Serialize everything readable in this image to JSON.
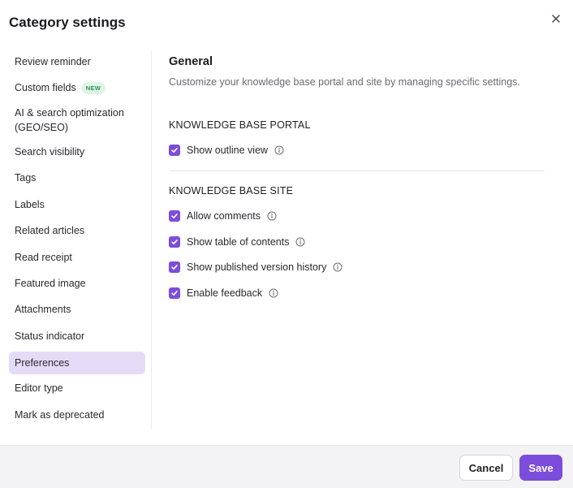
{
  "modal": {
    "title": "Category settings",
    "close_icon": "close-icon"
  },
  "sidebar": {
    "items": [
      {
        "label": "Review reminder"
      },
      {
        "label": "Custom fields",
        "badge": "NEW"
      },
      {
        "label": "AI & search optimization (GEO/SEO)"
      },
      {
        "label": "Search visibility"
      },
      {
        "label": "Tags"
      },
      {
        "label": "Labels"
      },
      {
        "label": "Related articles"
      },
      {
        "label": "Read receipt"
      },
      {
        "label": "Featured image"
      },
      {
        "label": "Attachments"
      },
      {
        "label": "Status indicator"
      },
      {
        "label": "Preferences",
        "active": true
      },
      {
        "label": "Editor type"
      },
      {
        "label": "Mark as deprecated"
      }
    ]
  },
  "main": {
    "title": "General",
    "description": "Customize your knowledge base portal and site by managing specific settings.",
    "groups": [
      {
        "heading": "KNOWLEDGE BASE PORTAL",
        "options": [
          {
            "label": "Show outline view",
            "checked": true
          }
        ]
      },
      {
        "heading": "KNOWLEDGE BASE SITE",
        "options": [
          {
            "label": "Allow comments",
            "checked": true
          },
          {
            "label": "Show table of contents",
            "checked": true
          },
          {
            "label": "Show published version history",
            "checked": true
          },
          {
            "label": "Enable feedback",
            "checked": true
          }
        ]
      }
    ]
  },
  "footer": {
    "cancel_label": "Cancel",
    "save_label": "Save"
  },
  "colors": {
    "accent": "#7c4ddb",
    "active_item_bg": "#e4dcf7",
    "new_badge_text": "#2f8f5a",
    "new_badge_bg": "#dff5e6"
  }
}
